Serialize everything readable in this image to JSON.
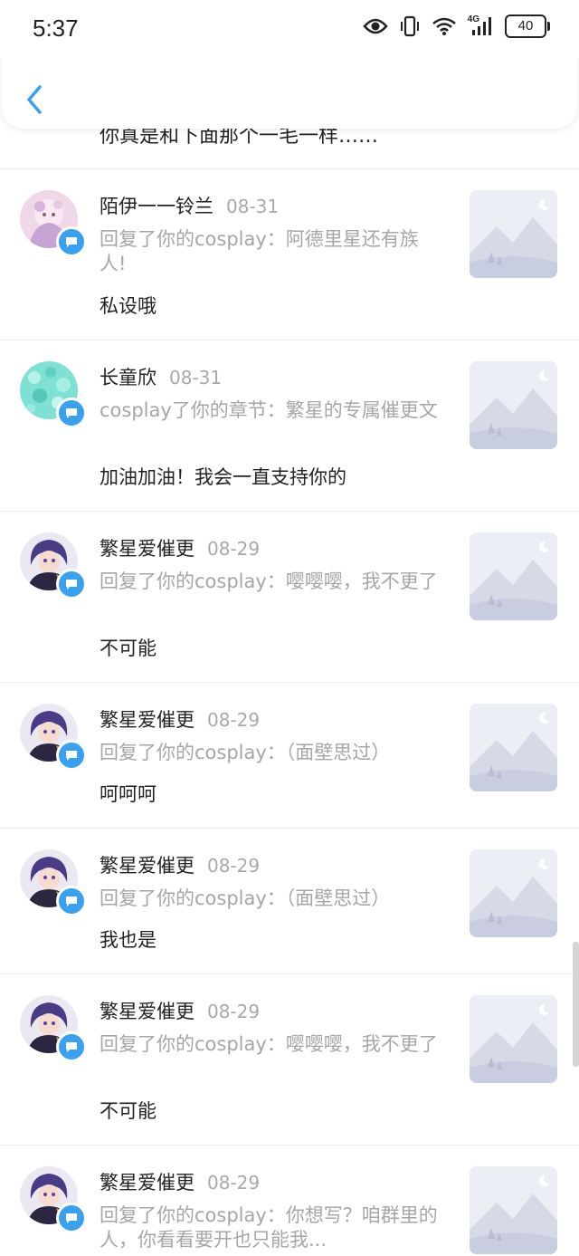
{
  "status": {
    "time": "5:37",
    "battery": "40",
    "network": "4G"
  },
  "header": {
    "back_icon": "chevron-left-icon"
  },
  "cutoff_text": "你真是和下面那个一毛一样……",
  "colors": {
    "accent": "#3aa0f0",
    "meta": "#a9a9a9",
    "text": "#222222"
  },
  "items": [
    {
      "name": "陌伊一一铃兰",
      "date": "08-31",
      "reply": "回复了你的cosplay：阿德里星还有族人!",
      "comment": "私设哦",
      "avatar": "pink-character"
    },
    {
      "name": "长童欣",
      "date": "08-31",
      "reply": "cosplay了你的章节：繁星的专属催更文",
      "comment": "加油加油！我会一直支持你的",
      "avatar": "teal-bubbles"
    },
    {
      "name": "繁星爱催更",
      "date": "08-29",
      "reply": "回复了你的cosplay：嘤嘤嘤，我不更了",
      "comment": "不可能",
      "avatar": "purple-character"
    },
    {
      "name": "繁星爱催更",
      "date": "08-29",
      "reply": "回复了你的cosplay：（面壁思过）",
      "comment": "呵呵呵",
      "avatar": "purple-character"
    },
    {
      "name": "繁星爱催更",
      "date": "08-29",
      "reply": "回复了你的cosplay：（面壁思过）",
      "comment": "我也是",
      "avatar": "purple-character"
    },
    {
      "name": "繁星爱催更",
      "date": "08-29",
      "reply": "回复了你的cosplay：嘤嘤嘤，我不更了",
      "comment": "不可能",
      "avatar": "purple-character"
    },
    {
      "name": "繁星爱催更",
      "date": "08-29",
      "reply": "回复了你的cosplay：你想写？咱群里的人，你看看要开也只能我...",
      "comment": "",
      "avatar": "purple-character"
    }
  ]
}
